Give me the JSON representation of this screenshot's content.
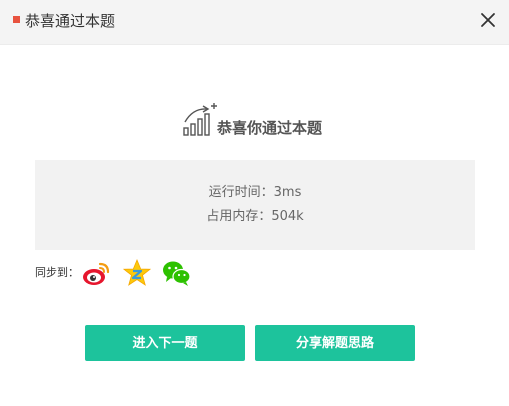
{
  "dialog": {
    "title": "恭喜通过本题",
    "close_icon": "close-icon",
    "accent_color": "#e8533f"
  },
  "result": {
    "headline": "恭喜你通过本题",
    "icon": "growth-chart-icon",
    "runtime_text": "运行时间：3ms",
    "memory_text": "占用内存：504k"
  },
  "sync": {
    "label": "同步到：",
    "targets": [
      {
        "name": "weibo",
        "icon": "weibo-icon"
      },
      {
        "name": "qzone",
        "icon": "qzone-icon"
      },
      {
        "name": "wechat",
        "icon": "wechat-icon"
      }
    ]
  },
  "actions": {
    "next_label": "进入下一题",
    "share_label": "分享解题思路",
    "button_color": "#1dc39c"
  }
}
